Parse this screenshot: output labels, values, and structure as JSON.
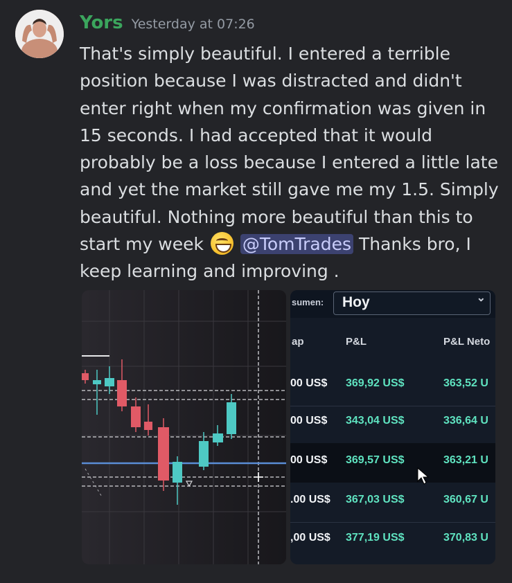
{
  "message": {
    "username": "Yors",
    "timestamp": "Yesterday at 07:26",
    "text_before": "That's simply beautiful. I entered a terrible position because I was distracted and didn't enter right when my confirmation was given in 15 seconds. I had accepted that it would probably be a loss because I entered a little late and yet the market still gave me my 1.5. Simply beautiful. Nothing more beautiful than this to start my week ",
    "emoji": "grinning-face-with-smiling-eyes",
    "mention": "@TomTrades",
    "text_after": " Thanks bro, I keep learning and improving ."
  },
  "table_image": {
    "summary_label": "sumen:",
    "period_value": "Hoy",
    "columns": [
      "ap",
      "P&L",
      "P&L Neto"
    ],
    "column_display": [
      "ap",
      "P&L",
      "P&L Neto"
    ],
    "rows": [
      [
        "00 US$",
        "369,92 US$",
        "363,52 U"
      ],
      [
        "00 US$",
        "343,04 US$",
        "336,64 U"
      ],
      [
        "00 US$",
        "369,57 US$",
        "363,21 U"
      ],
      [
        ".00 US$",
        "367,03 US$",
        "360,67 U"
      ],
      [
        ",00 US$",
        "377,19 US$",
        "370,83 U"
      ]
    ],
    "highlighted_row": 2
  },
  "colors": {
    "background": "#232428",
    "username": "#3ba55d",
    "mention_bg": "#3c4270",
    "pnl_green": "#5fe3c0",
    "candle_red": "#e05a66",
    "candle_teal": "#4ec9c4"
  }
}
